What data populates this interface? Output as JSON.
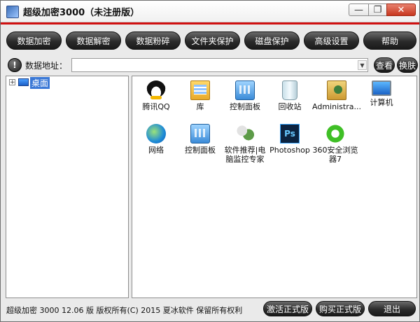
{
  "window": {
    "title": "超级加密3000（未注册版）",
    "min_glyph": "—",
    "max_glyph": "❐",
    "close_glyph": "✕"
  },
  "toolbar": {
    "buttons": [
      "数据加密",
      "数据解密",
      "数据粉碎",
      "文件夹保护",
      "磁盘保护",
      "高级设置",
      "帮助"
    ]
  },
  "address": {
    "info_glyph": "!",
    "label": "数据地址：",
    "value": "",
    "dropdown_glyph": "▼",
    "view_label": "查看",
    "switch_label": "换肤"
  },
  "tree": {
    "expander": "+",
    "root_label": "桌面"
  },
  "files": [
    {
      "label": "腾讯QQ",
      "icon": "qq-icon"
    },
    {
      "label": "库",
      "icon": "library-icon"
    },
    {
      "label": "控制面板",
      "icon": "control-panel-icon"
    },
    {
      "label": "回收站",
      "icon": "recycle-bin-icon"
    },
    {
      "label": "Administra...",
      "icon": "user-folder-icon"
    },
    {
      "label": "计算机",
      "icon": "computer-icon"
    },
    {
      "label": "网络",
      "icon": "network-icon"
    },
    {
      "label": "控制面板",
      "icon": "control-panel-icon"
    },
    {
      "label": "软件推荐|电脑监控专家",
      "icon": "software-icon"
    },
    {
      "label": "Photoshop",
      "icon": "photoshop-icon"
    },
    {
      "label": "360安全浏览器7",
      "icon": "browser-360-icon"
    }
  ],
  "ps_text": "Ps",
  "footer": {
    "status": "超级加密 3000  12.06 版   版权所有(C)  2015 夏冰软件  保留所有权利",
    "activate_label": "激活正式版",
    "buy_label": "购买正式版",
    "exit_label": "退出"
  }
}
